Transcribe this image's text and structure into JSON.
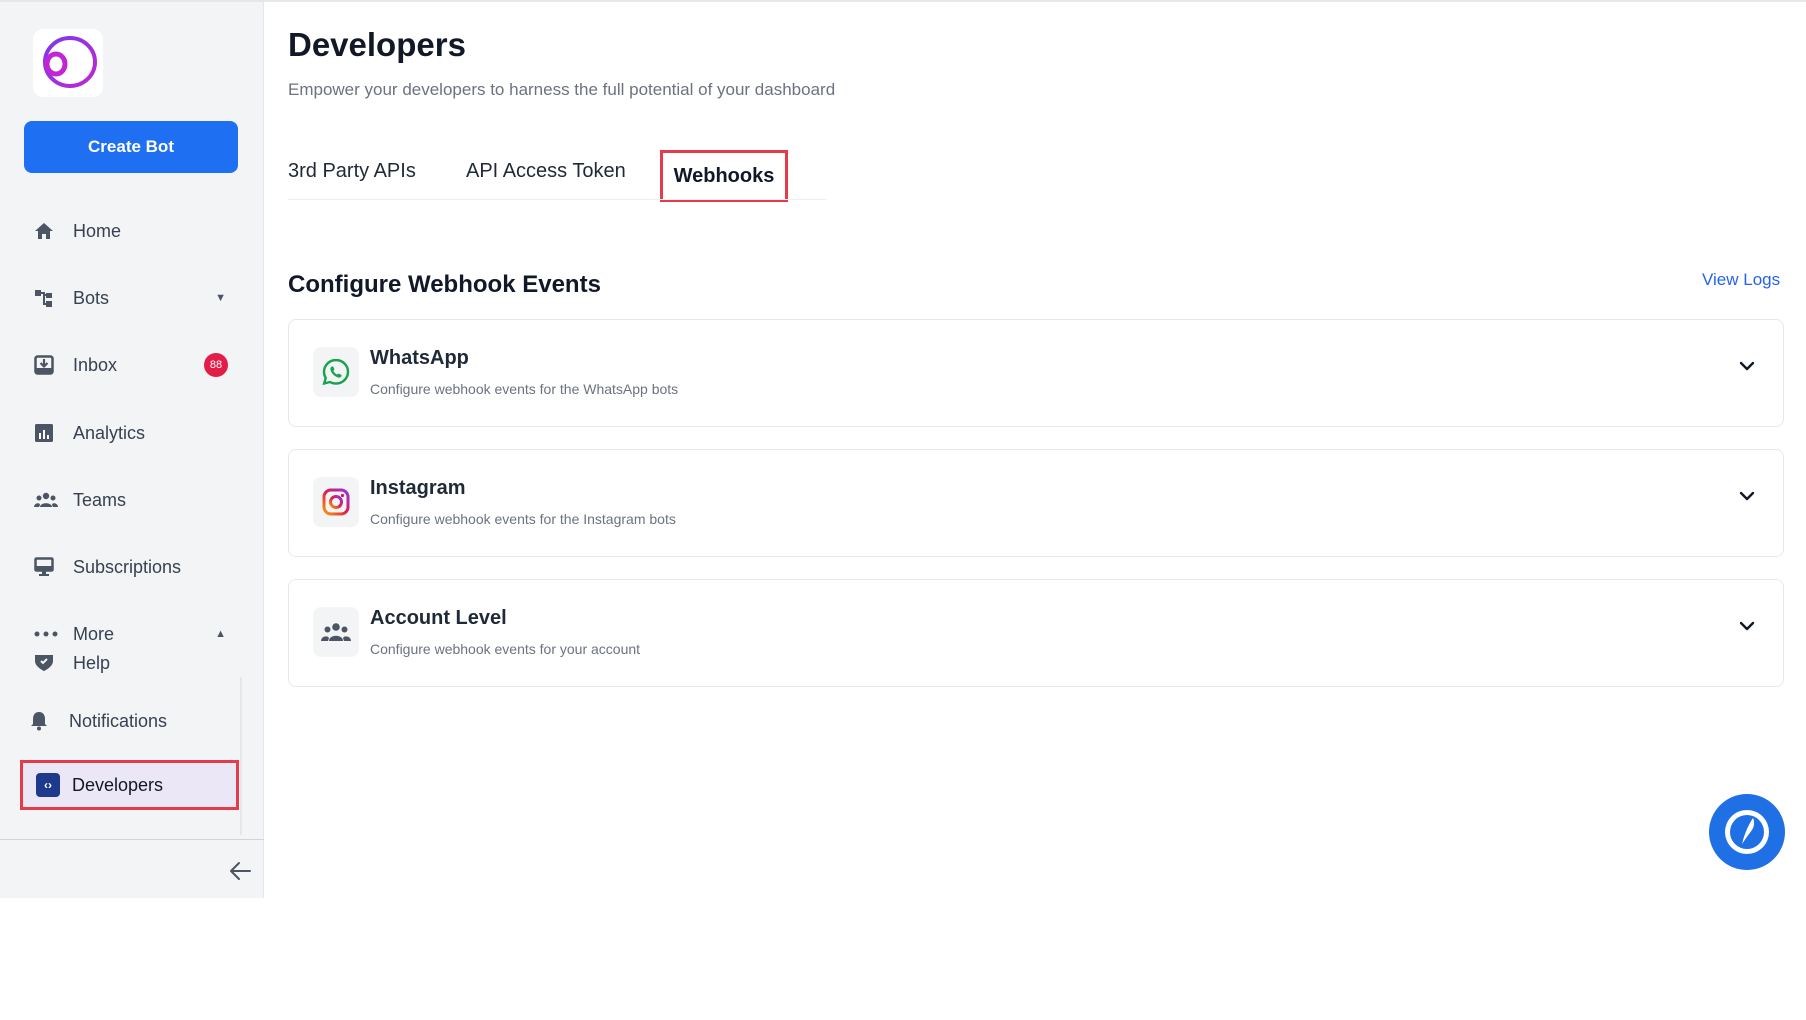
{
  "sidebar": {
    "create_bot_label": "Create Bot",
    "items": [
      {
        "label": "Home",
        "icon": "home-icon"
      },
      {
        "label": "Bots",
        "icon": "bots-icon"
      },
      {
        "label": "Inbox",
        "icon": "inbox-icon",
        "badge": "88"
      },
      {
        "label": "Analytics",
        "icon": "analytics-icon"
      },
      {
        "label": "Teams",
        "icon": "teams-icon"
      },
      {
        "label": "Subscriptions",
        "icon": "subscriptions-icon"
      },
      {
        "label": "More",
        "icon": "more-icon"
      },
      {
        "label": "Help",
        "icon": "help-icon"
      },
      {
        "label": "Notifications",
        "icon": "bell-icon"
      },
      {
        "label": "Developers",
        "icon": "code-icon",
        "active": true
      }
    ]
  },
  "page": {
    "title": "Developers",
    "subtitle": "Empower your developers to harness the full potential of your dashboard"
  },
  "tabs": [
    {
      "label": "3rd Party APIs"
    },
    {
      "label": "API Access Token"
    },
    {
      "label": "Webhooks",
      "active": true
    }
  ],
  "section": {
    "title": "Configure Webhook Events",
    "view_logs": "View Logs"
  },
  "cards": [
    {
      "title": "WhatsApp",
      "desc": "Configure webhook events for the WhatsApp bots",
      "icon": "whatsapp-icon"
    },
    {
      "title": "Instagram",
      "desc": "Configure webhook events for the Instagram bots",
      "icon": "instagram-icon"
    },
    {
      "title": "Account Level",
      "desc": "Configure webhook events for your account",
      "icon": "account-group-icon"
    }
  ],
  "colors": {
    "primary": "#1e6ff2",
    "highlight_border": "#e23b4a",
    "badge": "#e11d48",
    "link": "#2563eb",
    "active_bg": "#ebe7f7"
  }
}
